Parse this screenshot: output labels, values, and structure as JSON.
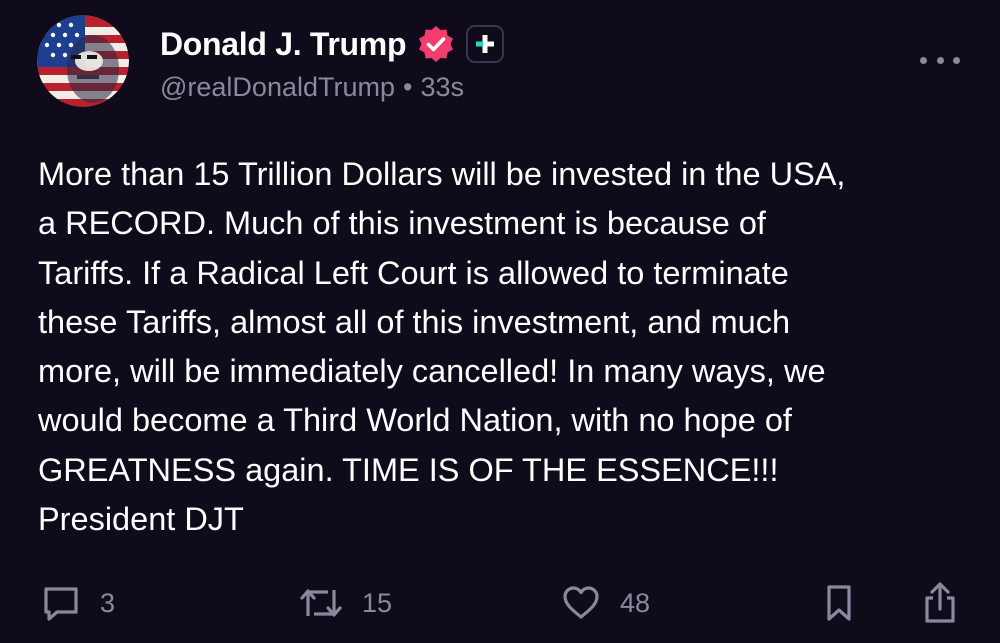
{
  "author": {
    "display_name": "Donald J. Trump",
    "handle": "@realDonaldTrump",
    "separator": "•",
    "timestamp": "33s",
    "verified_icon": "verified-badge-icon",
    "verified_color": "#f23d6e"
  },
  "post": {
    "text": "More than 15 Trillion Dollars will be invested in the USA,\na RECORD. Much of this investment is because of\nTariffs. If a Radical Left Court is allowed to terminate\nthese Tariffs, almost all of this investment, and much\nmore, will be immediately cancelled! In many ways, we\nwould become a Third World Nation, with no hope of\nGREATNESS again. TIME IS OF THE ESSENCE!!!\nPresident DJT"
  },
  "actions": {
    "replies": "3",
    "retruths": "15",
    "likes": "48"
  },
  "colors": {
    "background": "#0f0b1a",
    "text": "#ffffff",
    "muted": "#8c879c",
    "accent_teal": "#2bd4bd"
  }
}
